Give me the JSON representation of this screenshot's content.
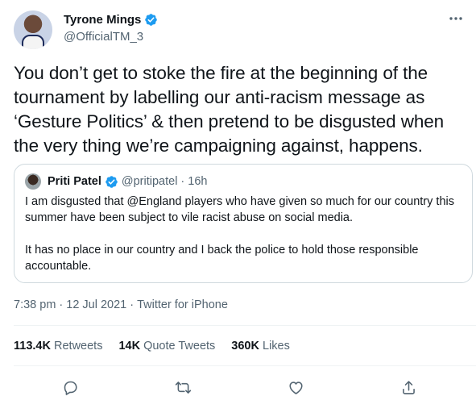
{
  "author": {
    "display_name": "Tyrone Mings",
    "handle": "@OfficialTM_3",
    "verified": true
  },
  "tweet": {
    "text": "You don’t get to stoke the fire at the beginning of the tournament by labelling our anti-racism message as ‘Gesture Politics’ & then pretend to be disgusted when the very thing we’re campaigning against, happens."
  },
  "quoted_tweet": {
    "display_name": "Priti Patel",
    "handle": "@pritipatel",
    "separator": "·",
    "age": "16h",
    "paragraph_1": "I am disgusted that @England players who have given so much for our country this summer have been subject to vile racist abuse on social media.",
    "paragraph_2": "It has no place in our country and I back the police to hold those responsible accountable."
  },
  "meta": {
    "time": "7:38 pm",
    "date": "12 Jul 2021",
    "source": "Twitter for iPhone",
    "separator": "·"
  },
  "stats": {
    "retweets_count": "113.4K",
    "retweets_label": "Retweets",
    "quotes_count": "14K",
    "quotes_label": "Quote Tweets",
    "likes_count": "360K",
    "likes_label": "Likes"
  },
  "colors": {
    "text_primary": "#0f1419",
    "text_secondary": "#536471",
    "verified_blue": "#1d9bf0",
    "border": "#cfd9de"
  },
  "icons": [
    "more-icon",
    "verified-icon",
    "reply-icon",
    "retweet-icon",
    "like-icon",
    "share-icon"
  ]
}
